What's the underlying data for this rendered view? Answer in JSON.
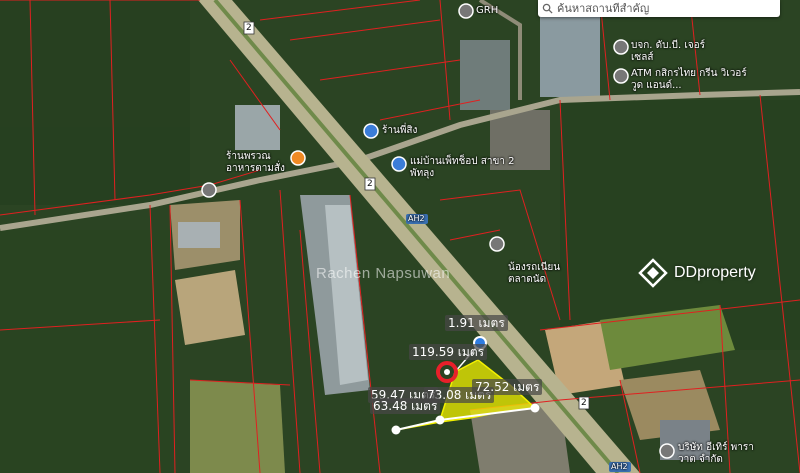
{
  "search": {
    "placeholder": "ค้นหาสถานที่สำคัญ",
    "icon": "search-icon"
  },
  "watermark": {
    "brand": "DDproperty",
    "icon": "ddproperty-logo-icon"
  },
  "credit": "Rachen Napsuwan",
  "roads": [
    {
      "label": "2"
    },
    {
      "label": "AH2"
    }
  ],
  "pois": [
    {
      "name": "GRH",
      "icon": "place-pin-icon"
    },
    {
      "name": "บจก. ดับ.บี. เจอร์ เซลส์",
      "icon": "place-pin-icon"
    },
    {
      "name": "ATM กสิกรไทย กรีน วิเวอร์วูด แอนด์...",
      "icon": "bank-pin-icon"
    },
    {
      "name": "ร้านพี่สิง",
      "icon": "shop-pin-icon"
    },
    {
      "name": "ร้านพรวณ อาหารตามสั่ง",
      "icon": "restaurant-pin-icon"
    },
    {
      "name": "แม่บ้านเพ็ทช็อป สาขา 2 พัทลุง",
      "icon": "shop-pin-icon"
    },
    {
      "name": "น้องรถเนียน ตลาดนัด",
      "icon": "place-pin-icon"
    },
    {
      "name": "บริษัท อีเทิร์ พาราวาต จำกัด",
      "icon": "place-pin-icon"
    }
  ],
  "measurements": [
    {
      "label": "1.91 เมตร"
    },
    {
      "label": "119.59 เมตร"
    },
    {
      "label": "59.47 เมตร"
    },
    {
      "label": "73.08 เมตร"
    },
    {
      "label": "72.52 เมตร"
    },
    {
      "label": "63.48 เมตร"
    }
  ],
  "colors": {
    "parcel_lines": "#e02020",
    "highlighted_parcel": "#f2f000",
    "selected_marker": "#e8202a",
    "road": "#b9b48c",
    "vegetation": "#2b4a26"
  }
}
